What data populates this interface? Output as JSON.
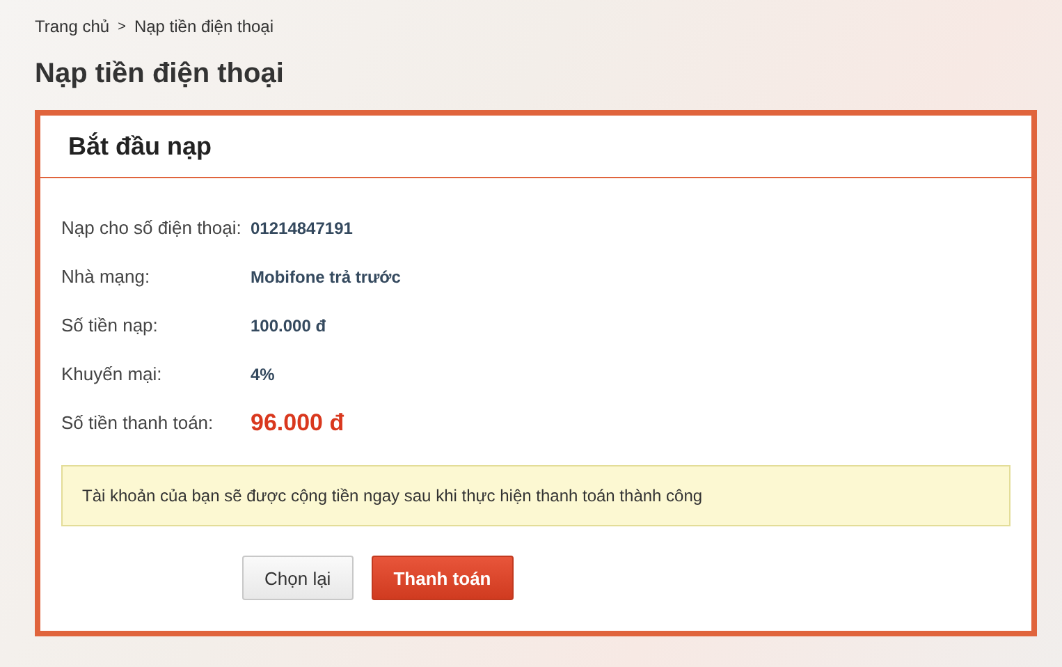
{
  "breadcrumb": {
    "home": "Trang chủ",
    "separator": ">",
    "current": "Nạp tiền điện thoại"
  },
  "page_title": "Nạp tiền điện thoại",
  "card": {
    "title": "Bắt đầu nạp",
    "rows": [
      {
        "label": "Nạp cho số điện thoại:",
        "value": "01214847191",
        "kind": "normal"
      },
      {
        "label": "Nhà mạng:",
        "value": "Mobifone trả trước",
        "kind": "normal"
      },
      {
        "label": "Số tiền nạp:",
        "value": "100.000 đ",
        "kind": "normal"
      },
      {
        "label": "Khuyến mại:",
        "value": "4%",
        "kind": "normal"
      },
      {
        "label": "Số tiền thanh toán:",
        "value": "96.000 đ",
        "kind": "total"
      }
    ],
    "notice": "Tài khoản của bạn sẽ được cộng tiền ngay sau khi thực hiện thanh toán thành công",
    "buttons": [
      {
        "label": "Chọn lại",
        "kind": "secondary"
      },
      {
        "label": "Thanh toán",
        "kind": "primary"
      }
    ]
  }
}
